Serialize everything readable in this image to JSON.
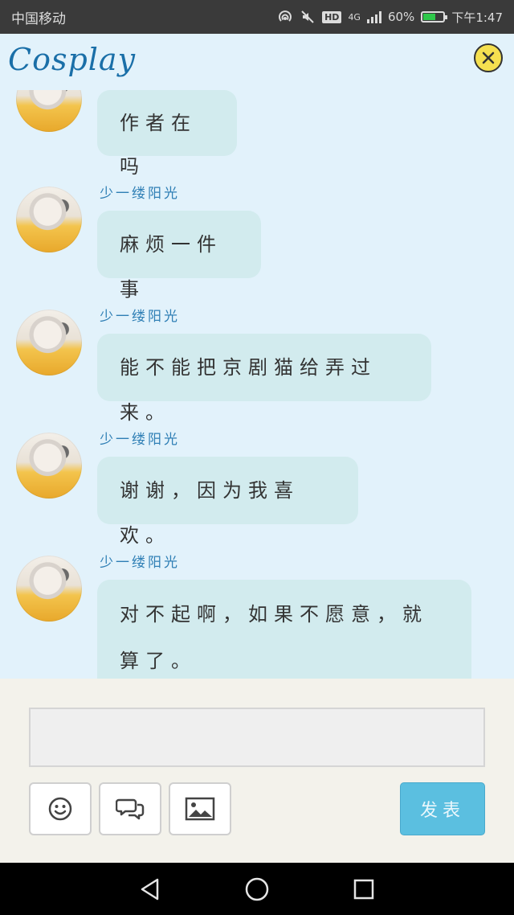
{
  "status_bar": {
    "carrier": "中国移动",
    "network": "4G",
    "hd": "HD",
    "battery": "60%",
    "battery_level": 0.6,
    "time": "下午1:47"
  },
  "header": {
    "title": "Cosplay",
    "close_icon": "close-circle-icon"
  },
  "messages": [
    {
      "sender": "",
      "text": "作者在吗"
    },
    {
      "sender": "少一缕阳光",
      "text": "麻烦一件事"
    },
    {
      "sender": "少一缕阳光",
      "text": "能不能把京剧猫给弄过来。"
    },
    {
      "sender": "少一缕阳光",
      "text": "谢谢，因为我喜欢。"
    },
    {
      "sender": "少一缕阳光",
      "text": "对不起啊，如果不愿意，就算了。"
    }
  ],
  "input": {
    "value": "",
    "placeholder": ""
  },
  "toolbar": {
    "emoji_icon": "emoji-icon",
    "chat_icon": "chat-bubbles-icon",
    "image_icon": "image-icon",
    "send_label": "发表"
  },
  "colors": {
    "background": "#e2f2fb",
    "bubble": "#d2ebee",
    "accent": "#5bbfe0",
    "title": "#1a6fa8",
    "sender": "#2f7fb5"
  }
}
